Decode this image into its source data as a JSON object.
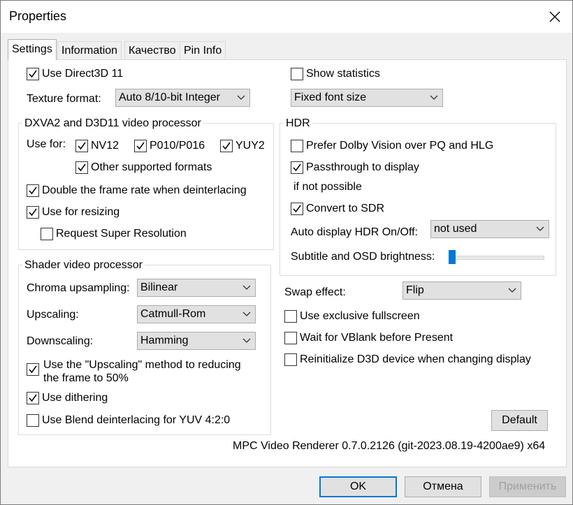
{
  "window": {
    "title": "Properties"
  },
  "tabs": [
    {
      "label": "Settings"
    },
    {
      "label": "Information"
    },
    {
      "label": "Качество"
    },
    {
      "label": "Pin Info"
    }
  ],
  "settings": {
    "use_d3d11": {
      "label": "Use Direct3D 11",
      "checked": true
    },
    "texture_format": {
      "label": "Texture format:",
      "value": "Auto 8/10-bit Integer"
    },
    "show_statistics": {
      "label": "Show statistics",
      "checked": false
    },
    "font_size": {
      "value": "Fixed font size"
    },
    "dxva": {
      "title": "DXVA2 and D3D11 video processor",
      "use_for": "Use for:",
      "nv12": {
        "label": "NV12",
        "checked": true
      },
      "p010": {
        "label": "P010/P016",
        "checked": true
      },
      "yuy2": {
        "label": "YUY2",
        "checked": true
      },
      "other": {
        "label": "Other supported formats",
        "checked": true
      },
      "double_rate": {
        "label": "Double the frame rate when deinterlacing",
        "checked": true
      },
      "resizing": {
        "label": "Use for resizing",
        "checked": true
      },
      "super_res": {
        "label": "Request Super Resolution",
        "checked": false
      }
    },
    "hdr": {
      "title": "HDR",
      "dolby": {
        "label": "Prefer Dolby Vision over PQ and HLG",
        "checked": false
      },
      "passthrough": {
        "label": "Passthrough to display",
        "checked": true
      },
      "if_not": "if not possible",
      "convert": {
        "label": "Convert to SDR",
        "checked": true
      },
      "auto_label": "Auto display HDR On/Off:",
      "auto_value": "not used",
      "brightness_label": "Subtitle and OSD brightness:",
      "brightness_level": 0
    },
    "shader": {
      "title": "Shader video processor",
      "chroma_label": "Chroma upsampling:",
      "chroma_value": "Bilinear",
      "upscaling_label": "Upscaling:",
      "upscaling_value": "Catmull-Rom",
      "downscaling_label": "Downscaling:",
      "downscaling_value": "Hamming",
      "upscale_method_line1": "Use the \"Upscaling\" method to reducing",
      "upscale_method_line2": "the frame to 50%",
      "upscale_method_checked": true,
      "dithering": {
        "label": "Use dithering",
        "checked": true
      },
      "blend": {
        "label": "Use Blend deinterlacing for YUV 4:2:0",
        "checked": false
      }
    },
    "swap_label": "Swap effect:",
    "swap_value": "Flip",
    "exclusive": {
      "label": "Use exclusive fullscreen",
      "checked": false
    },
    "vblank": {
      "label": "Wait for VBlank before Present",
      "checked": false
    },
    "reinit": {
      "label": "Reinitialize D3D device when changing display",
      "checked": false
    },
    "default_btn": "Default",
    "version": "MPC Video Renderer 0.7.0.2126 (git-2023.08.19-4200ae9) x64"
  },
  "buttons": {
    "ok": "OK",
    "cancel": "Отмена",
    "apply": "Применить"
  },
  "colors": {
    "accent": "#0078d7",
    "face": "#f0f0f0",
    "panel": "#ffffff"
  }
}
